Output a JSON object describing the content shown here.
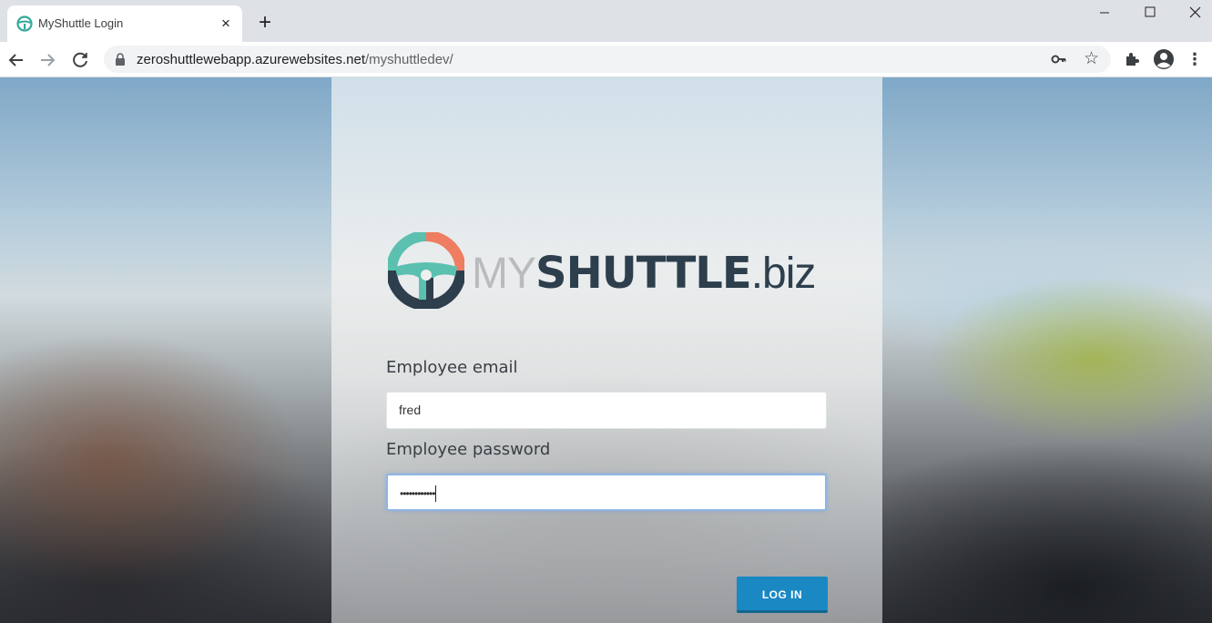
{
  "browser": {
    "tab": {
      "title": "MyShuttle Login",
      "close": "×",
      "favicon": "steering-wheel-icon"
    },
    "new_tab": "+",
    "window_controls": {
      "minimize": "minimize-icon",
      "maximize": "maximize-icon",
      "close": "close-icon"
    },
    "nav": {
      "back": "←",
      "forward": "→",
      "reload": "C"
    },
    "address_bar": {
      "host": "zeroshuttlewebapp.azurewebsites.net",
      "path": "/myshuttledev/"
    },
    "toolbar_icons": [
      "key-icon",
      "star-icon",
      "extensions-icon",
      "profile-icon",
      "menu-icon"
    ],
    "menu": "⋮",
    "star": "☆"
  },
  "login": {
    "brand": {
      "my": "MY",
      "shuttle": "SHUTTLE",
      "biz": ".biz"
    },
    "email_label": "Employee email",
    "email_value": "fred",
    "password_label": "Employee password",
    "password_mask": "••••••••••••",
    "login_button": "LOG IN"
  },
  "colors": {
    "accent": "#1a88c3",
    "brand_dark": "#2d3e4d",
    "logo_teal": "#5bc0b0",
    "logo_orange": "#ee7d61"
  }
}
